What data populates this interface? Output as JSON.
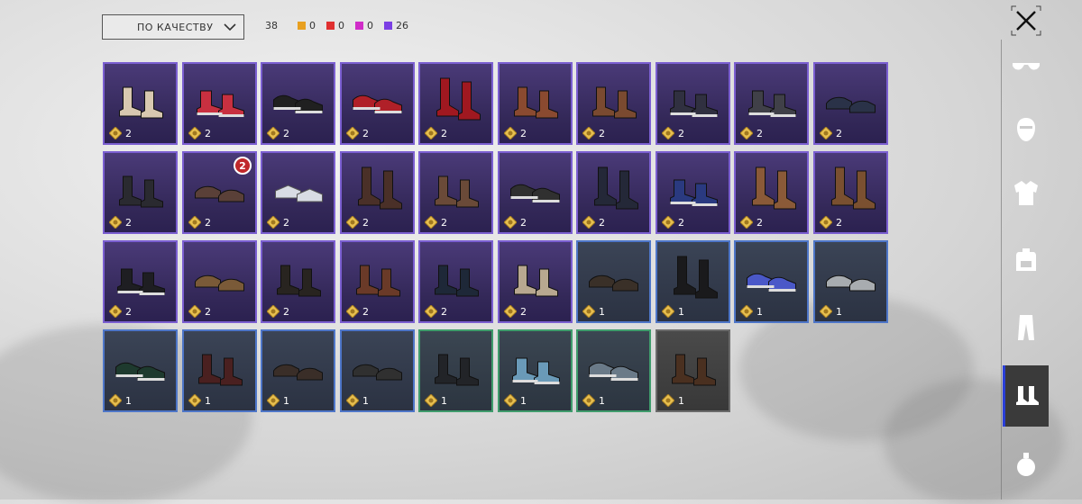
{
  "sort": {
    "label": "ПО КАЧЕСТВУ"
  },
  "counts": {
    "total": "38",
    "quality": [
      {
        "name": "orange",
        "color": "#e8a020",
        "value": "0"
      },
      {
        "name": "red",
        "color": "#e03030",
        "value": "0"
      },
      {
        "name": "pink",
        "color": "#d02cc8",
        "value": "0"
      },
      {
        "name": "purple",
        "color": "#7b3fe4",
        "value": "26"
      }
    ]
  },
  "categories": [
    {
      "name": "eyewear",
      "icon": "glasses-icon",
      "active": false
    },
    {
      "name": "mask",
      "icon": "mask-icon",
      "active": false
    },
    {
      "name": "jacket",
      "icon": "jacket-icon",
      "active": false
    },
    {
      "name": "backpack",
      "icon": "backpack-icon",
      "active": false
    },
    {
      "name": "pants",
      "icon": "pants-icon",
      "active": false
    },
    {
      "name": "shoes",
      "icon": "shoes-icon",
      "active": true
    },
    {
      "name": "emote",
      "icon": "grenade-icon",
      "active": false
    }
  ],
  "items": [
    {
      "quality": "purple",
      "count": "2",
      "color": "#d8c8b0",
      "style": "boot"
    },
    {
      "quality": "purple",
      "count": "2",
      "color": "#c83040",
      "style": "sneaker-high"
    },
    {
      "quality": "purple",
      "count": "2",
      "color": "#202020",
      "style": "sneaker"
    },
    {
      "quality": "purple",
      "count": "2",
      "color": "#b02028",
      "style": "sneaker"
    },
    {
      "quality": "purple",
      "count": "2",
      "color": "#a01820",
      "style": "tall"
    },
    {
      "quality": "purple",
      "count": "2",
      "color": "#8a4a30",
      "style": "boot"
    },
    {
      "quality": "purple",
      "count": "2",
      "color": "#7a4a30",
      "style": "boot"
    },
    {
      "quality": "purple",
      "count": "2",
      "color": "#303040",
      "style": "sneaker-high"
    },
    {
      "quality": "purple",
      "count": "2",
      "color": "#404048",
      "style": "sneaker-high"
    },
    {
      "quality": "purple",
      "count": "2",
      "color": "#2a3248",
      "style": "loafer"
    },
    {
      "quality": "purple",
      "count": "2",
      "color": "#2a2a30",
      "style": "boot"
    },
    {
      "quality": "purple",
      "count": "2",
      "color": "#5a4038",
      "style": "loafer",
      "badge": "2"
    },
    {
      "quality": "purple",
      "count": "2",
      "color": "#d8dce4",
      "style": "sandal"
    },
    {
      "quality": "purple",
      "count": "2",
      "color": "#4a3028",
      "style": "tall"
    },
    {
      "quality": "purple",
      "count": "2",
      "color": "#6a4a38",
      "style": "boot"
    },
    {
      "quality": "purple",
      "count": "2",
      "color": "#303030",
      "style": "sneaker"
    },
    {
      "quality": "purple",
      "count": "2",
      "color": "#242838",
      "style": "tall"
    },
    {
      "quality": "purple",
      "count": "2",
      "color": "#2a3a80",
      "style": "sneaker-high"
    },
    {
      "quality": "purple",
      "count": "2",
      "color": "#8a5a38",
      "style": "tall"
    },
    {
      "quality": "purple",
      "count": "2",
      "color": "#7a5030",
      "style": "tall"
    },
    {
      "quality": "purple",
      "count": "2",
      "color": "#1e1e22",
      "style": "sneaker-high"
    },
    {
      "quality": "purple",
      "count": "2",
      "color": "#7a5a38",
      "style": "loafer"
    },
    {
      "quality": "purple",
      "count": "2",
      "color": "#282420",
      "style": "boot"
    },
    {
      "quality": "purple",
      "count": "2",
      "color": "#6a3a28",
      "style": "boot"
    },
    {
      "quality": "purple",
      "count": "2",
      "color": "#1e2838",
      "style": "boot"
    },
    {
      "quality": "purple",
      "count": "2",
      "color": "#b8a890",
      "style": "boot"
    },
    {
      "quality": "blue",
      "count": "1",
      "color": "#3a3028",
      "style": "loafer"
    },
    {
      "quality": "blue",
      "count": "1",
      "color": "#1a1a1c",
      "style": "tall"
    },
    {
      "quality": "blue",
      "count": "1",
      "color": "#4a58c8",
      "style": "sneaker"
    },
    {
      "quality": "blue",
      "count": "1",
      "color": "#a8acb0",
      "style": "loafer"
    },
    {
      "quality": "blue",
      "count": "1",
      "color": "#1e3a2e",
      "style": "sneaker"
    },
    {
      "quality": "blue",
      "count": "1",
      "color": "#4a2020",
      "style": "boot"
    },
    {
      "quality": "blue",
      "count": "1",
      "color": "#3a2e28",
      "style": "loafer"
    },
    {
      "quality": "blue",
      "count": "1",
      "color": "#303030",
      "style": "loafer"
    },
    {
      "quality": "green",
      "count": "1",
      "color": "#222428",
      "style": "boot"
    },
    {
      "quality": "green",
      "count": "1",
      "color": "#6a9ab8",
      "style": "sneaker-high"
    },
    {
      "quality": "green",
      "count": "1",
      "color": "#6a7a88",
      "style": "sneaker"
    },
    {
      "quality": "gray",
      "count": "1",
      "color": "#4a3020",
      "style": "boot"
    }
  ]
}
